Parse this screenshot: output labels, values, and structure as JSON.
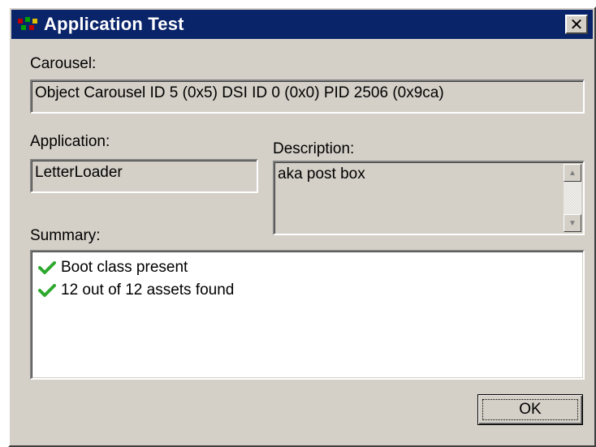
{
  "window": {
    "title": "Application Test",
    "icon": "app-icon",
    "close_label": "✕"
  },
  "carousel": {
    "label": "Carousel:",
    "value": "Object Carousel ID 5 (0x5) DSI ID 0 (0x0) PID 2506 (0x9ca)"
  },
  "application": {
    "label": "Application:",
    "value": "LetterLoader"
  },
  "description": {
    "label": "Description:",
    "value": "aka post box"
  },
  "summary": {
    "label": "Summary:",
    "items": [
      {
        "icon": "check-icon",
        "text": "Boot class present"
      },
      {
        "icon": "check-icon",
        "text": "12 out of 12 assets found"
      }
    ]
  },
  "buttons": {
    "ok_label": "OK"
  },
  "colors": {
    "titlebar": "#0a246a",
    "dialog_bg": "#d4d0c8",
    "check": "#2ea82e"
  }
}
